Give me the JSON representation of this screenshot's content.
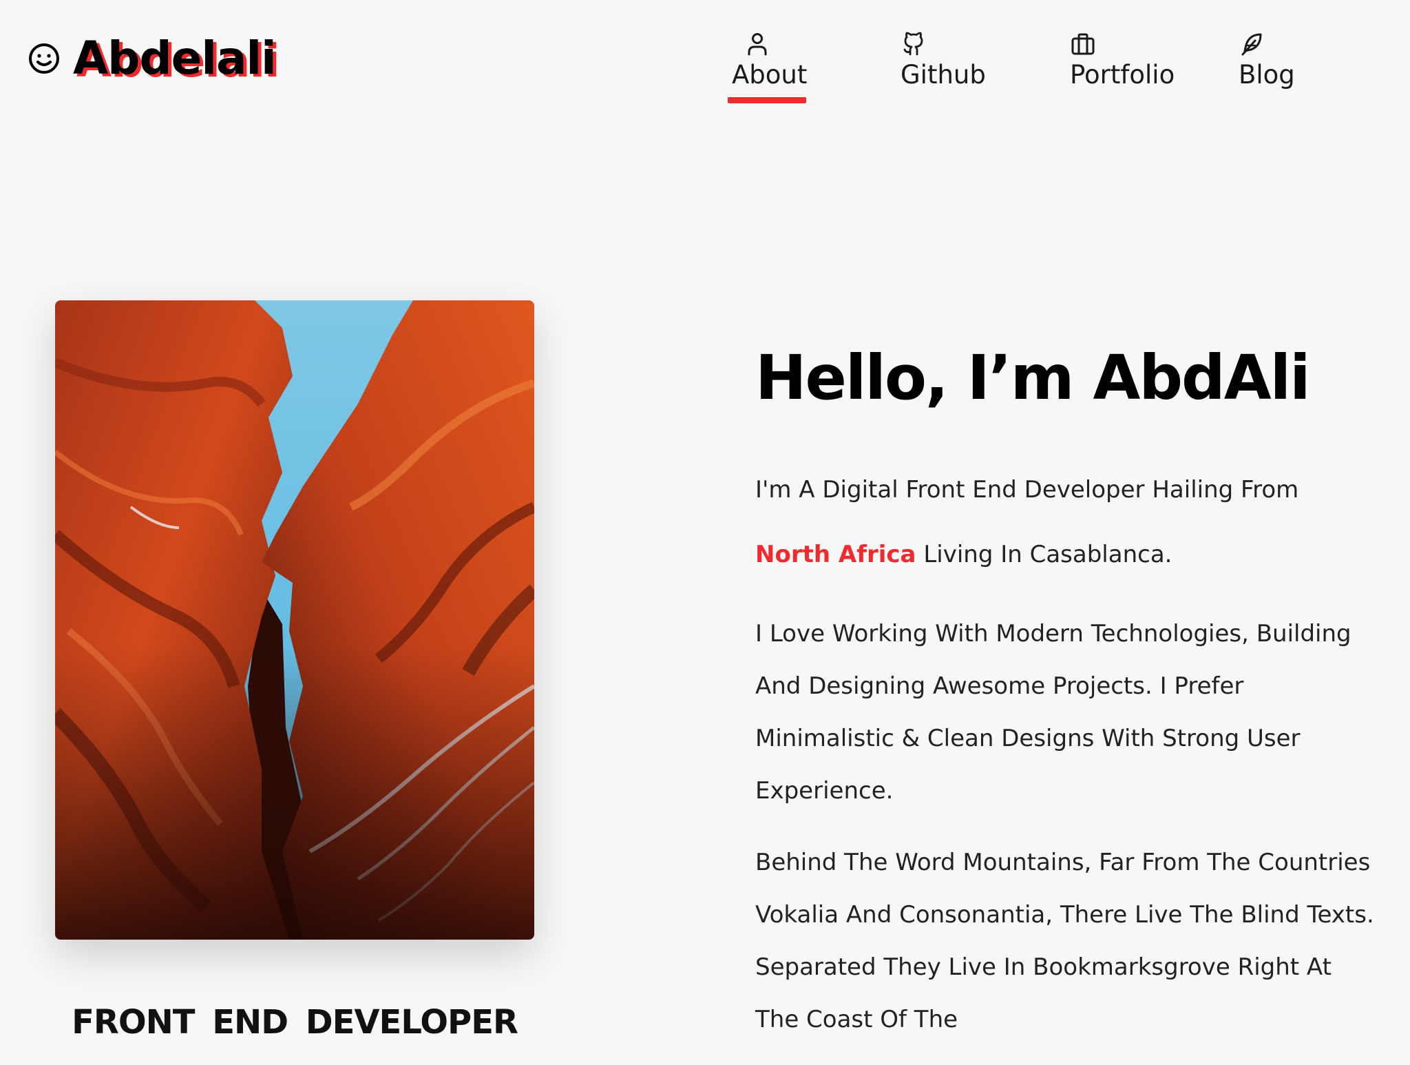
{
  "brand": {
    "name": "Abdelali",
    "icon": "smiley-icon",
    "accent_color": "#ef2b2d"
  },
  "nav": {
    "items": [
      {
        "label": "About",
        "icon": "user-icon",
        "active": true
      },
      {
        "label": "Github",
        "icon": "github-icon",
        "active": false
      },
      {
        "label": "Portfolio",
        "icon": "briefcase-icon",
        "active": false
      },
      {
        "label": "Blog",
        "icon": "feather-icon",
        "active": false
      }
    ]
  },
  "profile": {
    "photo_subject": "canyon-photo",
    "role": "FRONT END DEVELOPER"
  },
  "intro": {
    "heading": "Hello, I’m AbdAli",
    "p1_before": "I'm A Digital Front End Developer Hailing From ",
    "p1_highlight": "North Africa",
    "p1_after": " Living In Casablanca.",
    "p2": "I Love Working With Modern Technologies, Building And Designing Awesome Projects. I Prefer Minimalistic & Clean Designs With Strong User Experience.",
    "p3": "Behind The Word Mountains, Far From The Countries Vokalia And Consonantia, There Live The Blind Texts. Separated They Live In Bookmarksgrove Right At The Coast Of The"
  }
}
